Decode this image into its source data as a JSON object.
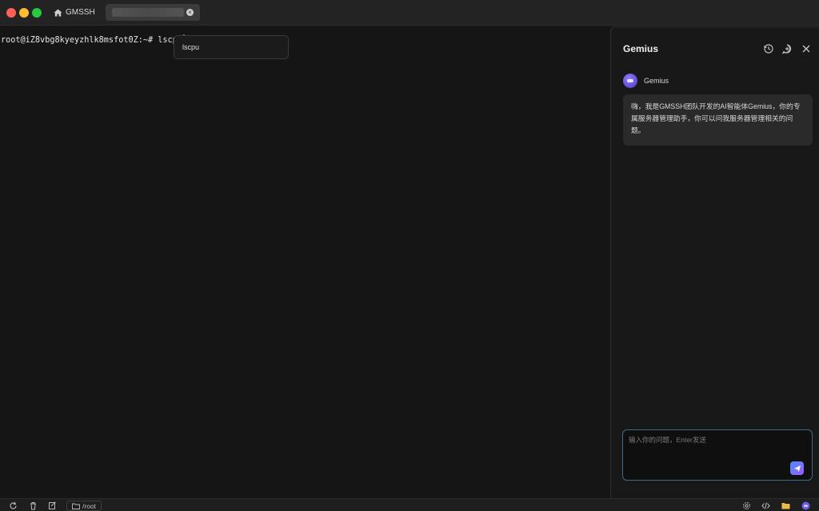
{
  "tabs": {
    "home_label": "GMSSH"
  },
  "terminal": {
    "prompt": "root@iZ8vbg8kyeyzhlk8msfot0Z:~# lscpu",
    "suggestion": "lscpu"
  },
  "assistant": {
    "title": "Gemius",
    "bot_name": "Gemius",
    "message": "嗨，我是GMSSH团队开发的AI智能体Gemius，你的专属服务器管理助手，你可以问我服务器管理相关的问题。",
    "input_placeholder": "输入你的问题，Enter发送"
  },
  "statusbar": {
    "path": "/root"
  },
  "colors": {
    "accent_send": "#7a6bff",
    "cursor": "#3fb950",
    "input_border": "#3b6d86"
  },
  "icons": [
    "home-icon",
    "close-icon",
    "history-icon",
    "new-chat-icon",
    "panel-close-icon",
    "send-icon",
    "refresh-icon",
    "trash-icon",
    "edit-icon",
    "folder-icon",
    "settings-icon",
    "code-icon",
    "folder-yellow-icon",
    "gemius-icon"
  ]
}
